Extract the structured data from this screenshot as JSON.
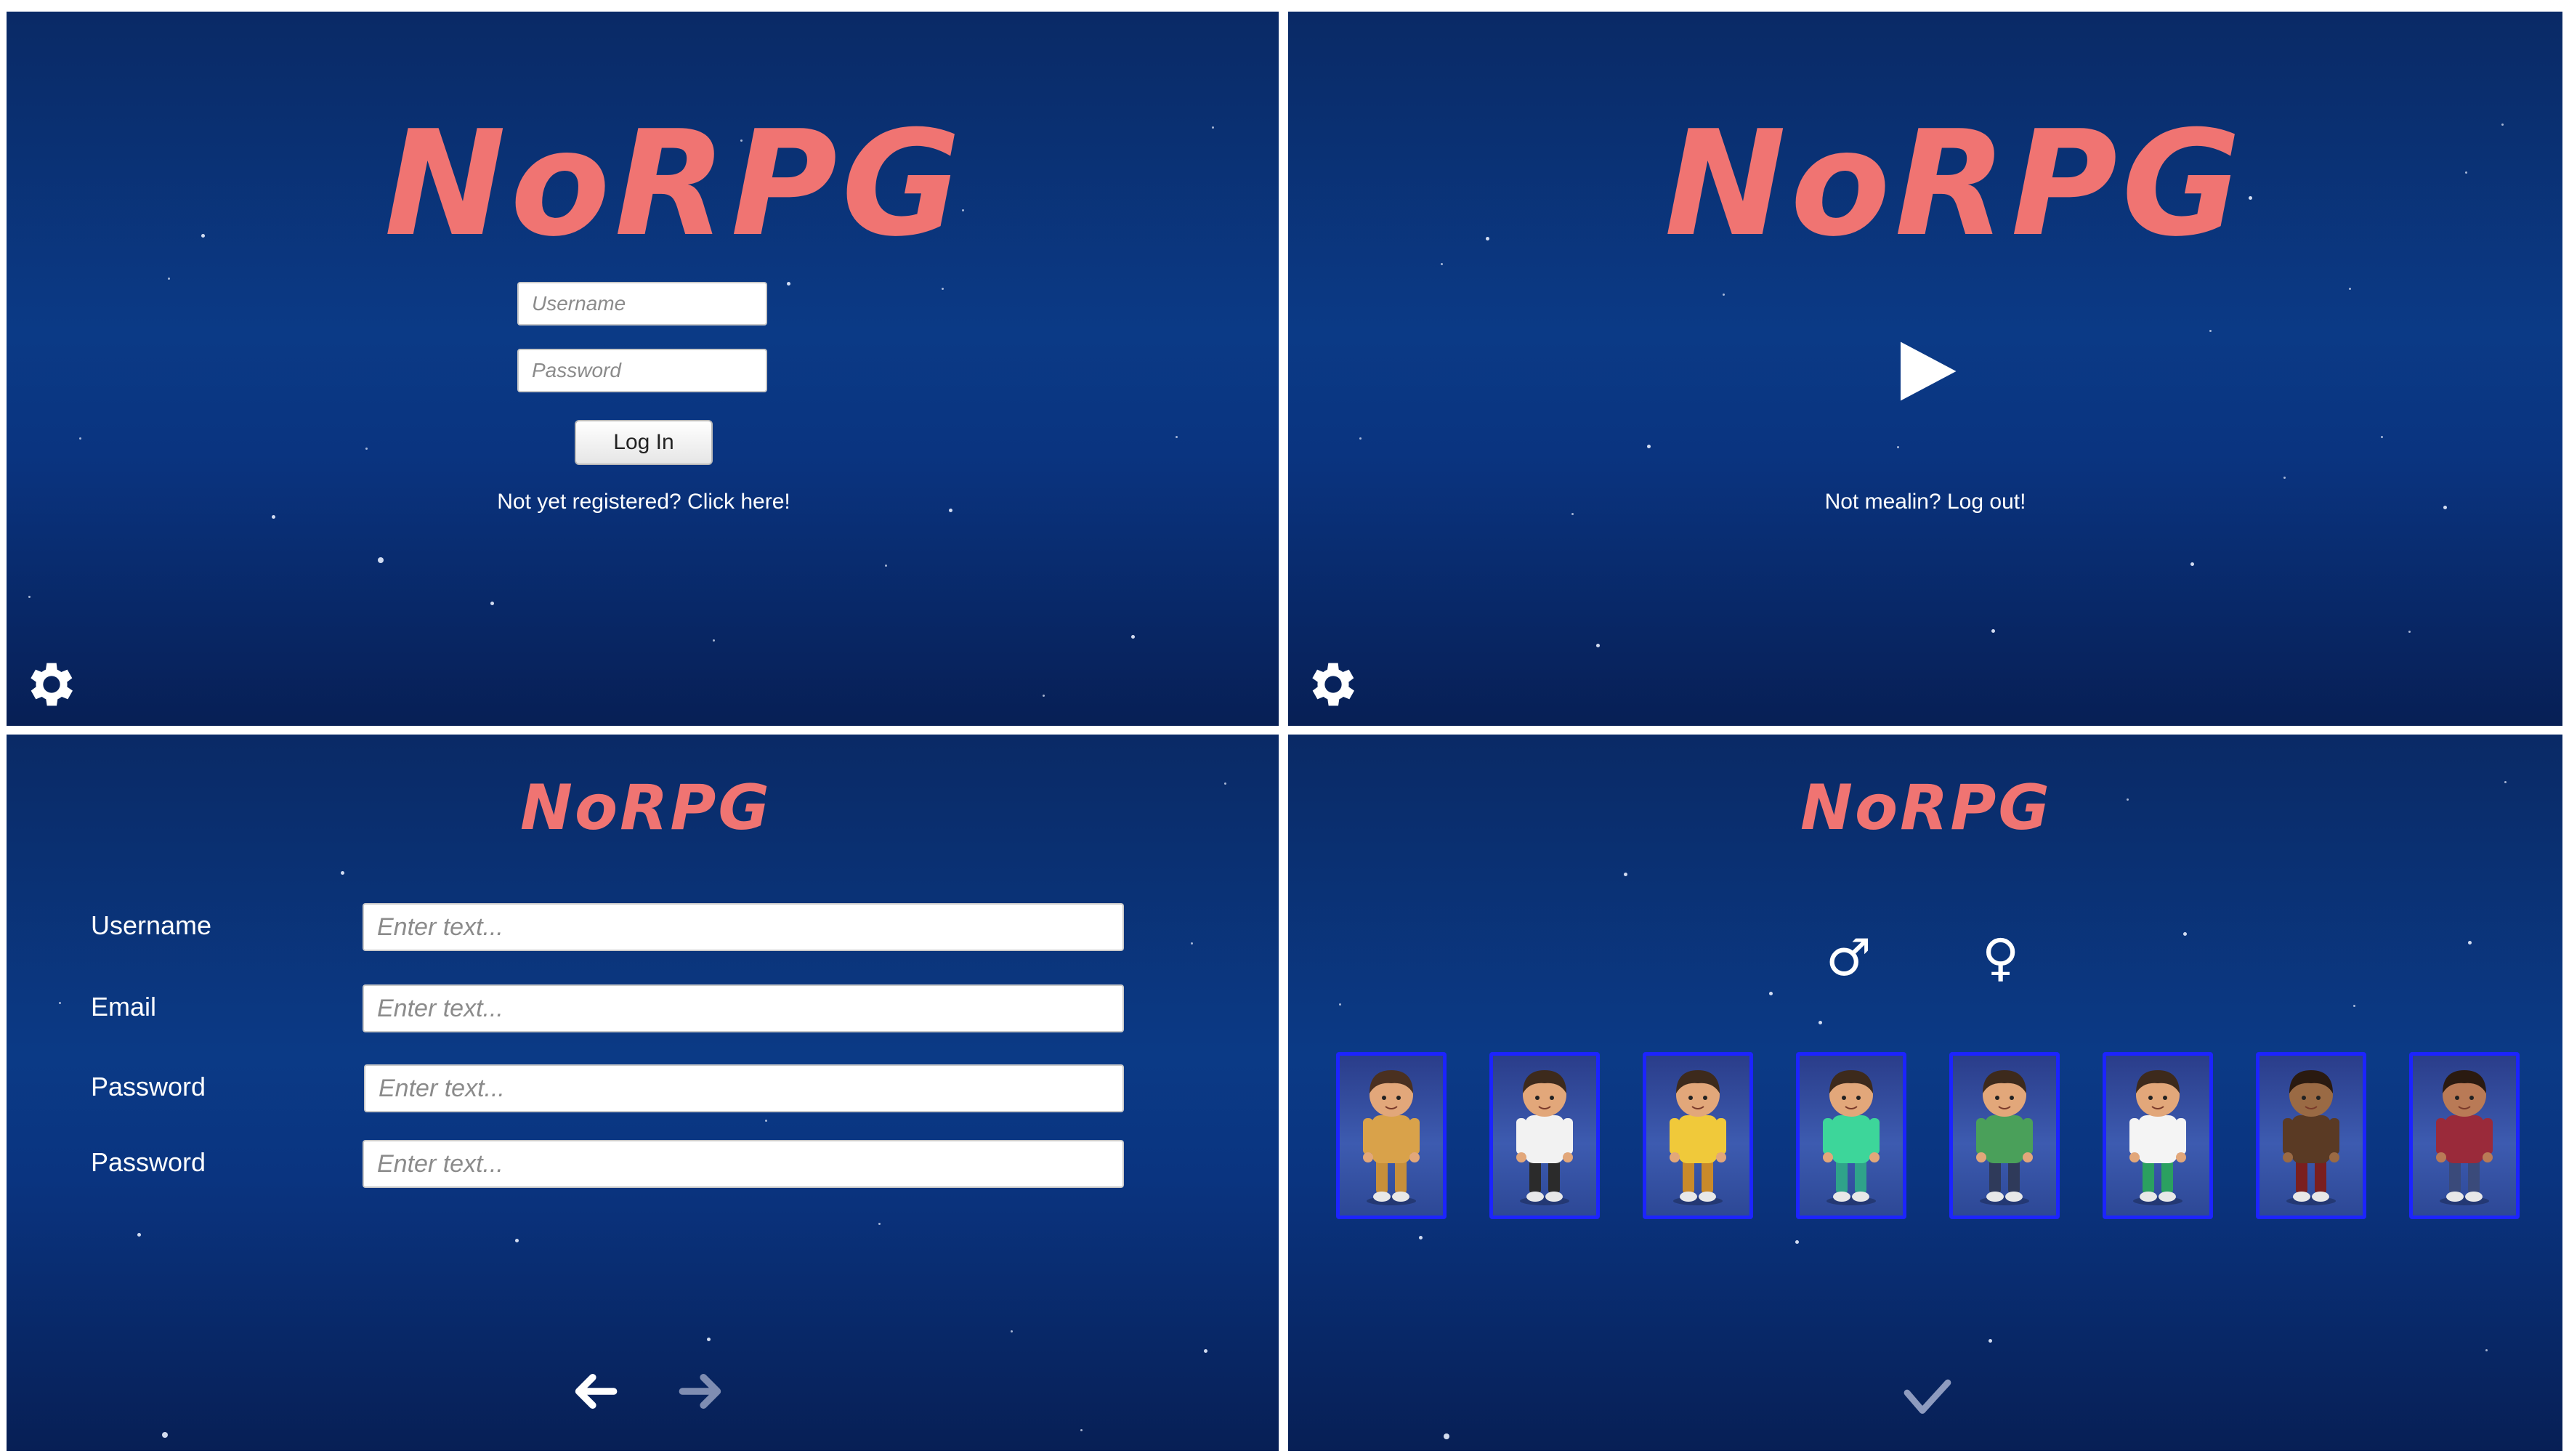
{
  "app": {
    "title": "NoRPG"
  },
  "login": {
    "username_placeholder": "Username",
    "password_placeholder": "Password",
    "login_button": "Log In",
    "register_link": "Not yet registered? Click here!"
  },
  "start": {
    "logout_link": "Not mealin? Log out!"
  },
  "register": {
    "fields": [
      {
        "label": "Username",
        "placeholder": "Enter text..."
      },
      {
        "label": "Email",
        "placeholder": "Enter text..."
      },
      {
        "label": "Password",
        "placeholder": "Enter text..."
      },
      {
        "label": "Password",
        "placeholder": "Enter text..."
      }
    ]
  },
  "character": {
    "male_symbol": "♂",
    "female_symbol": "♀",
    "avatars": [
      {
        "shirt": "#d9a24a",
        "pants": "#c78f3a",
        "skin": "#e2a77a",
        "hair": "#4a3020"
      },
      {
        "shirt": "#f2f2f2",
        "pants": "#2b2b2b",
        "skin": "#e2a77a",
        "hair": "#3d2a1c"
      },
      {
        "shirt": "#f0c93a",
        "pants": "#c98a2a",
        "skin": "#e2a77a",
        "hair": "#3d2a1c"
      },
      {
        "shirt": "#3dd69a",
        "pants": "#2fa38a",
        "skin": "#e2a77a",
        "hair": "#3d2a1c"
      },
      {
        "shirt": "#4aa05a",
        "pants": "#2f3a5a",
        "skin": "#e2a77a",
        "hair": "#3d2a1c"
      },
      {
        "shirt": "#f4f4f4",
        "pants": "#2ba060",
        "skin": "#e2a77a",
        "hair": "#3d2a1c"
      },
      {
        "shirt": "#5a3a24",
        "pants": "#7a1f1f",
        "skin": "#9a6a44",
        "hair": "#2a1a10"
      },
      {
        "shirt": "#9a2a3a",
        "pants": "#3a4a7a",
        "skin": "#b97a56",
        "hair": "#2a1a10"
      }
    ]
  },
  "colors": {
    "logo": "#f07472",
    "panel_top": "#0a2a66",
    "card_border": "#1c24ff"
  },
  "icons": {
    "settings": "gear-icon",
    "play": "play-icon",
    "back": "arrow-left-icon",
    "next": "arrow-right-icon",
    "confirm": "checkmark-icon"
  }
}
